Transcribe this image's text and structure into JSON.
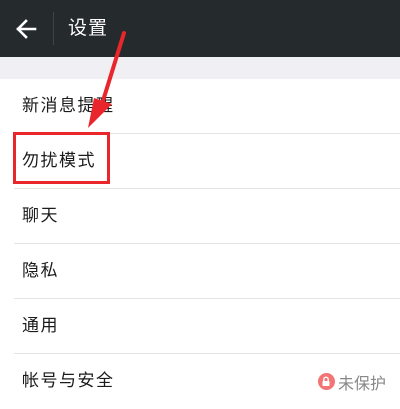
{
  "header": {
    "title": "设置",
    "back_icon": "arrow-left-icon"
  },
  "settings": {
    "items": [
      {
        "label": "新消息提醒"
      },
      {
        "label": "勿扰模式"
      },
      {
        "label": "聊天"
      },
      {
        "label": "隐私"
      },
      {
        "label": "通用"
      },
      {
        "label": "帐号与安全",
        "status": "未保护",
        "status_icon": "lock-icon"
      }
    ]
  },
  "annotation": {
    "color": "#e8262b",
    "highlighted_item": "勿扰模式"
  }
}
